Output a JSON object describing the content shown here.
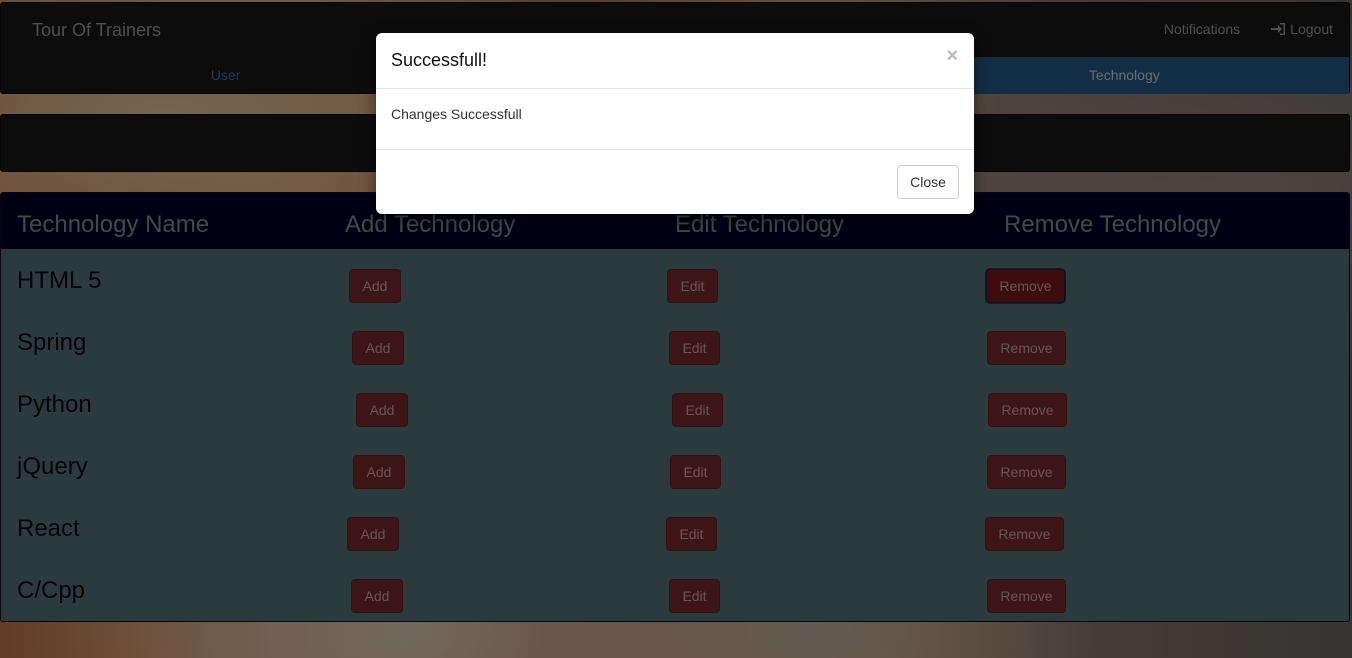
{
  "navbar": {
    "brand": "Tour Of Trainers",
    "notifications": "Notifications",
    "logout": "Logout",
    "tabs": [
      "User",
      "",
      "Technology"
    ]
  },
  "table": {
    "headers": [
      "Technology Name",
      "Add Technology",
      "Edit Technology",
      "Remove Technology"
    ],
    "rows": [
      {
        "name": "HTML 5",
        "add": "Add",
        "edit": "Edit",
        "remove": "Remove"
      },
      {
        "name": "Spring",
        "add": "Add",
        "edit": "Edit",
        "remove": "Remove"
      },
      {
        "name": "Python",
        "add": "Add",
        "edit": "Edit",
        "remove": "Remove"
      },
      {
        "name": "jQuery",
        "add": "Add",
        "edit": "Edit",
        "remove": "Remove"
      },
      {
        "name": "React",
        "add": "Add",
        "edit": "Edit",
        "remove": "Remove"
      },
      {
        "name": "C/Cpp",
        "add": "Add",
        "edit": "Edit",
        "remove": "Remove"
      }
    ]
  },
  "modal": {
    "title": "Successfull!",
    "close_icon": "×",
    "body": "Changes Successfull",
    "close_button": "Close"
  },
  "colors": {
    "navbar": "#181818",
    "active_tab": "#265a88",
    "table_header": "#00002b",
    "table_body": "#577478",
    "danger_button": "#7d2b2c"
  }
}
